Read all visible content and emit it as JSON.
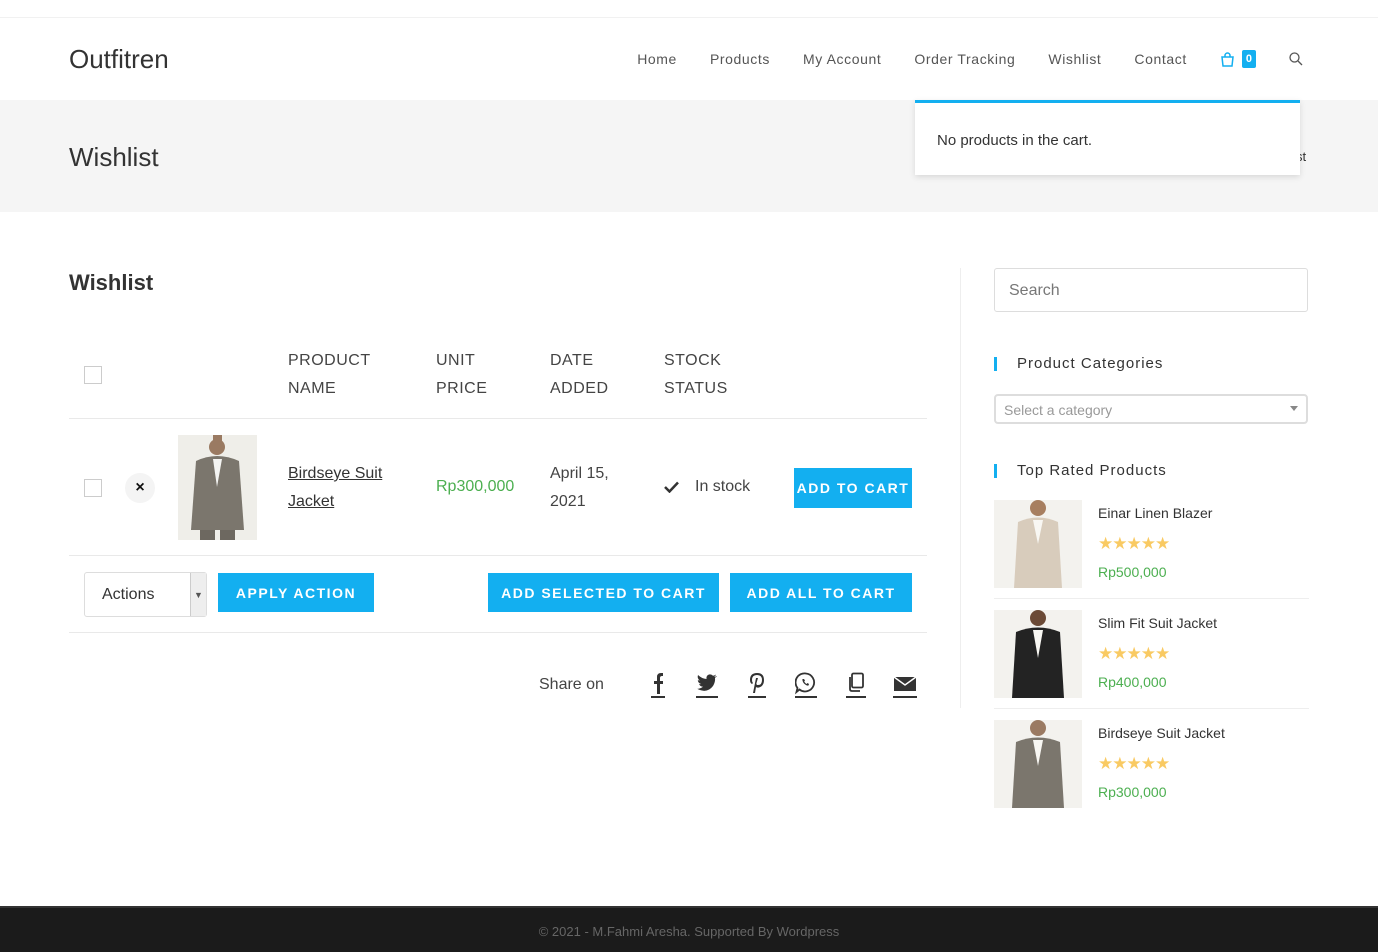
{
  "site": {
    "logo": "Outfitren"
  },
  "nav": {
    "items": [
      "Home",
      "Products",
      "My Account",
      "Order Tracking",
      "Wishlist",
      "Contact"
    ],
    "cart_count": "0",
    "icons": {
      "cart": "shopping-bag-icon",
      "search": "search-icon"
    }
  },
  "cart_dropdown": {
    "message": "No products in the cart."
  },
  "page_header": {
    "title": "Wishlist",
    "breadcrumb_tail": "st"
  },
  "wishlist": {
    "title": "Wishlist",
    "columns": {
      "product_name": [
        "PRODUCT",
        "NAME"
      ],
      "unit_price": [
        "UNIT",
        "PRICE"
      ],
      "date_added": [
        "DATE",
        "ADDED"
      ],
      "stock_status": [
        "STOCK",
        "STATUS"
      ]
    },
    "rows": [
      {
        "remove": "×",
        "name": "Birdseye Suit Jacket",
        "price": "Rp300,000",
        "date": "April 15, 2021",
        "stock": "In stock",
        "add_to_cart": "ADD TO CART"
      }
    ],
    "actions": {
      "select_value": "Actions",
      "apply": "APPLY ACTION",
      "add_selected": "ADD SELECTED TO CART",
      "add_all": "ADD ALL TO CART"
    },
    "share": {
      "label": "Share on",
      "icons": [
        "facebook-icon",
        "twitter-icon",
        "pinterest-icon",
        "whatsapp-icon",
        "copy-link-icon",
        "email-icon"
      ]
    }
  },
  "sidebar": {
    "search_placeholder": "Search",
    "categories_title": "Product Categories",
    "category_select": "Select a category",
    "top_rated_title": "Top Rated Products",
    "top_rated": [
      {
        "name": "Einar Linen Blazer",
        "price": "Rp500,000",
        "rating": 5
      },
      {
        "name": "Slim Fit Suit Jacket",
        "price": "Rp400,000",
        "rating": 5
      },
      {
        "name": "Birdseye Suit Jacket",
        "price": "Rp300,000",
        "rating": 5
      }
    ]
  },
  "footer": {
    "text": "© 2021 - M.Fahmi Aresha. Supported By Wordpress"
  },
  "colors": {
    "accent": "#13aff0",
    "price": "#4caf50",
    "stars": "#f9ca63",
    "footer_bg": "#1b1b1b"
  }
}
